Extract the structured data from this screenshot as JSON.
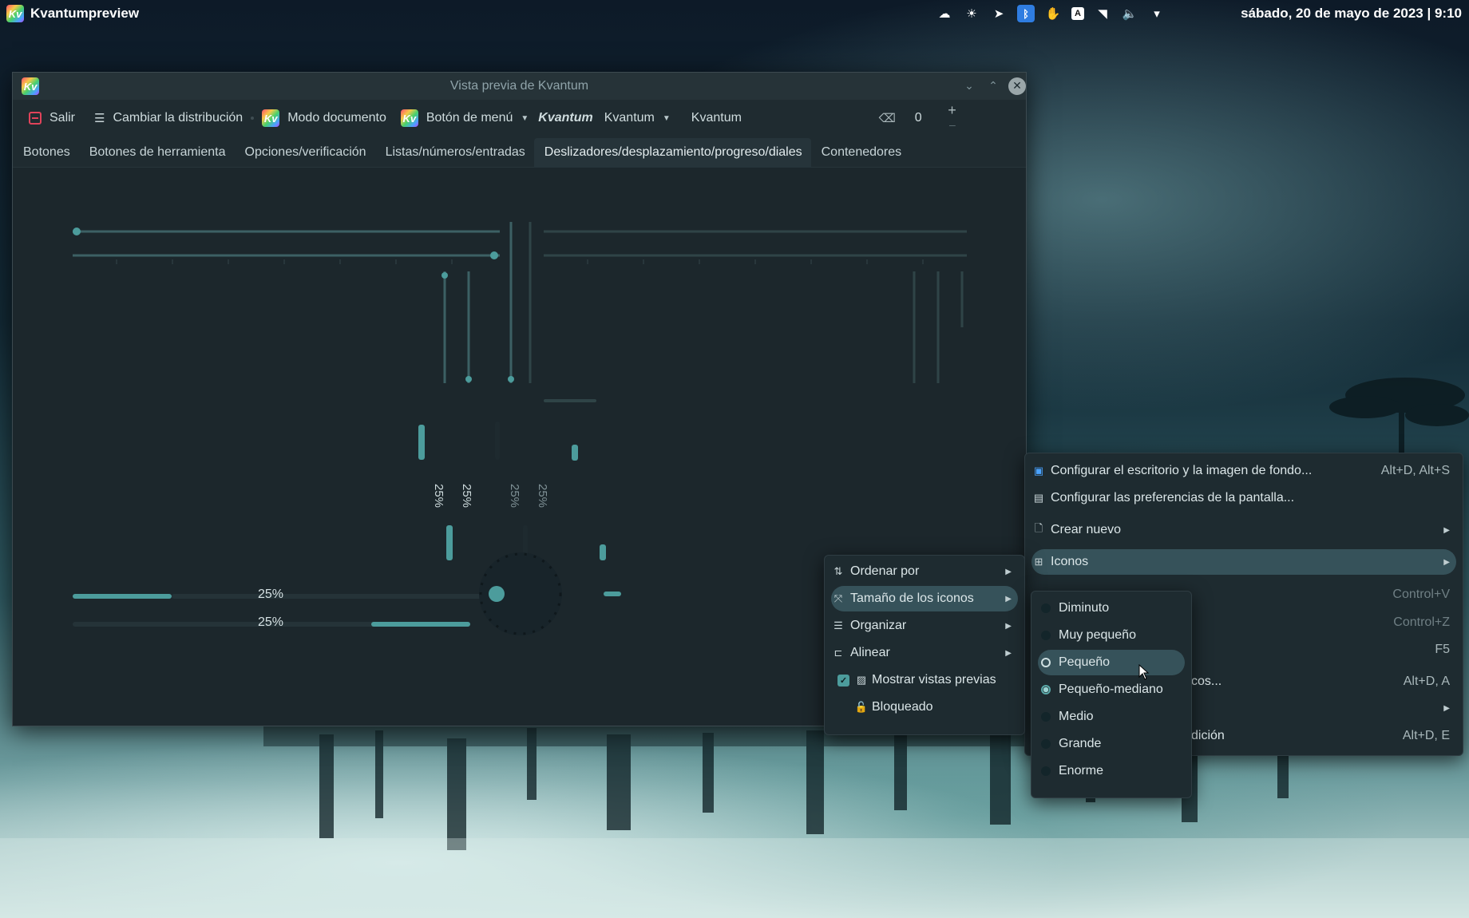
{
  "panel": {
    "app_name": "Kvantumpreview",
    "clock": "sábado, 20 de mayo de 2023 | 9:10",
    "tray_icons": [
      "cloud-icon",
      "weather-icon",
      "telegram-icon",
      "bluetooth-icon",
      "hand-icon",
      "vpn-icon",
      "wifi-icon",
      "volume-icon",
      "tray-expand-icon"
    ]
  },
  "window": {
    "title": "Vista previa de Kvantum",
    "logo_text": "Kv",
    "toolbar": {
      "exit": "Salir",
      "change_layout": "Cambiar la distribución",
      "document_mode": "Modo documento",
      "menu_button": "Botón de menú",
      "bold_label": "Kvantum",
      "combo_value": "Kvantum",
      "search_value": "Kvantum",
      "spin_value": "0"
    },
    "tabs": [
      {
        "label": "Botones"
      },
      {
        "label": "Botones de herramienta"
      },
      {
        "label": "Opciones/verificación"
      },
      {
        "label": "Listas/números/entradas"
      },
      {
        "label": "Deslizadores/desplazamiento/progreso/diales"
      },
      {
        "label": "Contenedores"
      }
    ],
    "active_tab": 4,
    "progress": {
      "value_percent": 25,
      "label_1": "25%",
      "label_2": "25%",
      "vlabel_1": "25%",
      "vlabel_2": "25%",
      "vlabel_3": "25%",
      "vlabel_4": "25%"
    }
  },
  "desktop_menu": {
    "items": [
      {
        "label": "Configurar el escritorio y la imagen de fondo...",
        "shortcut": "Alt+D, Alt+S"
      },
      {
        "label": "Configurar las preferencias de la pantalla..."
      },
      {
        "label": "Crear nuevo"
      },
      {
        "label": "Iconos"
      },
      {
        "label": "",
        "shortcut": "Control+V"
      },
      {
        "label": "",
        "shortcut": "Control+Z"
      },
      {
        "label": "",
        "shortcut": "F5"
      },
      {
        "label": "cos...",
        "shortcut": "Alt+D, A"
      },
      {
        "label": ""
      },
      {
        "label": "dición",
        "shortcut": "Alt+D, E"
      }
    ]
  },
  "icons_menu": {
    "items": [
      {
        "label": "Ordenar por"
      },
      {
        "label": "Tamaño de los iconos"
      },
      {
        "label": "Organizar"
      },
      {
        "label": "Alinear"
      },
      {
        "label": "Mostrar vistas previas"
      },
      {
        "label": "Bloqueado"
      }
    ]
  },
  "size_menu": {
    "items": [
      {
        "label": "Diminuto"
      },
      {
        "label": "Muy pequeño"
      },
      {
        "label": "Pequeño"
      },
      {
        "label": "Pequeño-mediano"
      },
      {
        "label": "Medio"
      },
      {
        "label": "Grande"
      },
      {
        "label": "Enorme"
      }
    ],
    "selected": "Pequeño-mediano",
    "hovered": "Pequeño"
  },
  "colors": {
    "accent": "#4c9c9c",
    "highlight": "#36525a",
    "window_bg": "#1f2b30"
  }
}
